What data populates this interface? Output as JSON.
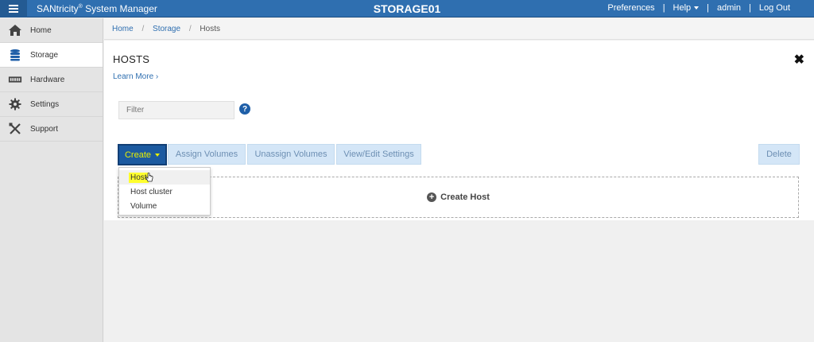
{
  "topbar": {
    "brand_prefix": "SANtricity",
    "brand_reg": "®",
    "brand_suffix": " System Manager",
    "system_name": "STORAGE01",
    "links": {
      "preferences": "Preferences",
      "help": "Help",
      "admin": "admin",
      "logout": "Log Out"
    },
    "separator": "|"
  },
  "sidebar": {
    "items": [
      {
        "label": "Home",
        "icon": "home-icon"
      },
      {
        "label": "Storage",
        "icon": "database-icon",
        "active": true
      },
      {
        "label": "Hardware",
        "icon": "hardware-icon"
      },
      {
        "label": "Settings",
        "icon": "gear-icon"
      },
      {
        "label": "Support",
        "icon": "tools-icon"
      }
    ]
  },
  "breadcrumb": {
    "home": "Home",
    "storage": "Storage",
    "current": "Hosts",
    "sep": "/"
  },
  "page": {
    "title": "HOSTS",
    "learn_more": "Learn More ›",
    "close": "✖",
    "filter_placeholder": "Filter",
    "help": "?"
  },
  "toolbar": {
    "create": "Create",
    "assign_volumes": "Assign Volumes",
    "unassign_volumes": "Unassign Volumes",
    "view_edit_settings": "View/Edit Settings",
    "delete": "Delete"
  },
  "create_menu": {
    "items": [
      "Host",
      "Host cluster",
      "Volume"
    ],
    "highlighted": "Host"
  },
  "empty_state": {
    "label": "Create Host"
  },
  "colors": {
    "topbar": "#2f6fb0",
    "create_button": "#1c5aa0",
    "create_text": "#e8f000",
    "disabled_button": "#d4e6f7",
    "highlight": "#ffff2e"
  }
}
